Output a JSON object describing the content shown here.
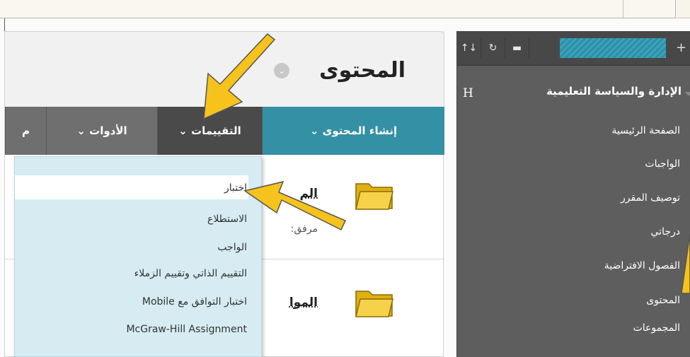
{
  "sidebar": {
    "course_title": "الإدارة والسياسة التعليمية",
    "course_marker": "H",
    "toolbar": {
      "sort_icon": "↑↓",
      "refresh_icon": "↻",
      "folder_icon": "▬",
      "add_icon": "+"
    },
    "items": [
      {
        "label": "الصفحة الرئيسية"
      },
      {
        "label": "الواجبات"
      },
      {
        "label": "توصيف المقرر"
      },
      {
        "label": "درجاتي"
      },
      {
        "label": "الفصول الافتراضية"
      },
      {
        "label": "المحتوى"
      },
      {
        "label": "المجموعات"
      }
    ]
  },
  "main": {
    "page_title": "المحتوى",
    "tabs": {
      "create": "إنشاء المحتوى ⌄",
      "assessments": "التقييمات ⌄",
      "tools": "الأدوات ⌄",
      "more": "م"
    },
    "rows": [
      {
        "title": "الم",
        "subtitle": "مرفق: إ"
      },
      {
        "title": "الموا",
        "subtitle": ""
      }
    ]
  },
  "assessments_menu": {
    "items": [
      "اختبار",
      "الاستطلاع",
      "الواجب",
      "التقييم الذاتي وتقييم الزملاء",
      "اختبار التوافق مع Mobile",
      "McGraw-Hill Assignment"
    ]
  },
  "colors": {
    "sidebar_bg": "#5e5e5e",
    "create_tab": "#3490a4",
    "assess_tab": "#4a4a4a",
    "menu_bg": "#d6ecf2",
    "arrow_fill": "#f6c21c"
  }
}
